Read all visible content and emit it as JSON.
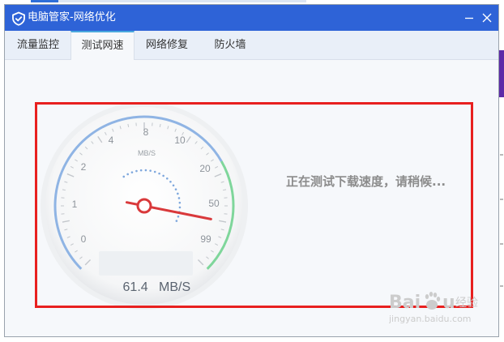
{
  "window": {
    "title": "电脑管家-网络优化"
  },
  "tabs": [
    {
      "label": "流量监控",
      "active": false
    },
    {
      "label": "测试网速",
      "active": true
    },
    {
      "label": "网络修复",
      "active": false
    },
    {
      "label": "防火墙",
      "active": false
    }
  ],
  "gauge": {
    "unit": "MB/S",
    "tick_labels": [
      "0",
      "1",
      "2",
      "4",
      "8",
      "10",
      "20",
      "50",
      "99"
    ],
    "speed_value": "61.4",
    "speed_unit": "MB/S",
    "needle_value": 50
  },
  "status_text": "正在测试下载速度，请稍候...",
  "watermark": {
    "brand": "Baidu 经验",
    "url": "jingyan.baidu.com"
  },
  "colors": {
    "titlebar": "#2e63d7",
    "gauge_arc_blue": "#8fb4e4",
    "gauge_arc_green": "#7fd69b",
    "needle": "#d9393b",
    "highlight": "#e8201f"
  }
}
